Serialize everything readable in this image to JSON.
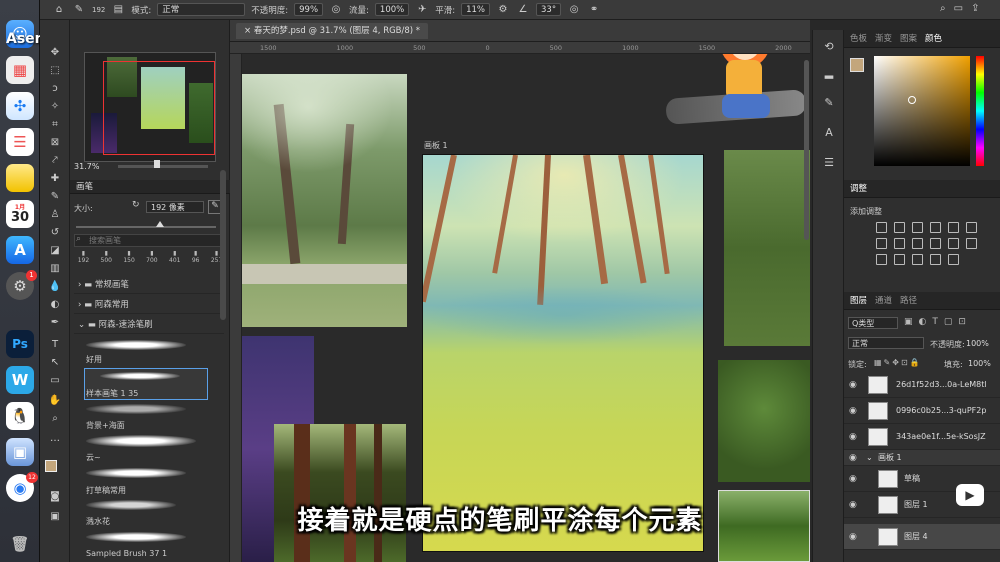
{
  "options_bar": {
    "brush_size": "192",
    "mode_label": "模式:",
    "mode_value": "正常",
    "opacity_label": "不透明度:",
    "opacity_value": "99%",
    "flow_label": "流量:",
    "flow_value": "100%",
    "smooth_label": "平滑:",
    "smooth_value": "11%",
    "angle_value": "33°"
  },
  "watermark": "Asen-阿森 bilibili",
  "dock": {
    "calendar_month": "1月",
    "calendar_day": "30",
    "badge_count_1": "1",
    "badge_count_2": "12"
  },
  "navigator": {
    "zoom": "31.7%"
  },
  "brush_panel": {
    "title": "画笔",
    "size_label": "大小:",
    "size_value": "192 像素",
    "search_placeholder": "搜索画笔",
    "preset_sizes": [
      "192",
      "500",
      "150",
      "700",
      "401",
      "96",
      "257"
    ],
    "folders": [
      "常规画笔",
      "阿森常用",
      "阿森-速涂笔刷"
    ],
    "brushes": [
      {
        "name": "好用"
      },
      {
        "name": "样本画笔 1 35"
      },
      {
        "name": "背景+海面"
      },
      {
        "name": "云~"
      },
      {
        "name": "打草稿常用"
      },
      {
        "name": "溅水花"
      },
      {
        "name": "Sampled Brush 37 1"
      }
    ]
  },
  "document": {
    "tab_title": "春天的梦.psd @ 31.7% (图层 4, RGB/8) *",
    "artboard_label": "画板 1",
    "ruler_ticks": [
      "1500",
      "1000",
      "500",
      "0",
      "500",
      "1000",
      "1500",
      "2000",
      "2500",
      "3000"
    ]
  },
  "color_panel": {
    "tabs": [
      "色板",
      "渐变",
      "图案",
      "颜色"
    ],
    "active_tab": "颜色",
    "fg_color": "#c3a67c",
    "hue_color": "#f0a000"
  },
  "adjust_panel": {
    "title": "调整",
    "add_label": "添加调整"
  },
  "layers_panel": {
    "tabs": [
      "图层",
      "通道",
      "路径"
    ],
    "active_tab": "图层",
    "filter_label": "Q类型",
    "blend_mode": "正常",
    "opacity_label": "不透明度:",
    "opacity_value": "100%",
    "lock_label": "锁定:",
    "fill_label": "填充:",
    "fill_value": "100%",
    "layers": [
      {
        "name": "26d1f52d3...0a-LeM8tl"
      },
      {
        "name": "0996c0b25...3-quPF2p"
      },
      {
        "name": "343ae0e1f...5e-kSosJZ"
      },
      {
        "name": "画板 1"
      },
      {
        "name": "草稿"
      },
      {
        "name": "图层 1"
      },
      {
        "name": "图层 4"
      }
    ]
  },
  "subtitle": "接着就是硬点的笔刷平涂每个元素"
}
